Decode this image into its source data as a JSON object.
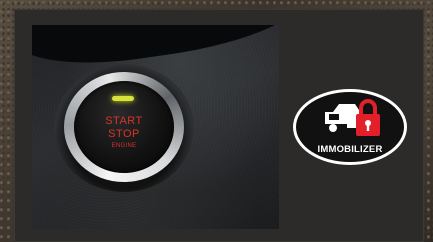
{
  "photo": {
    "button_text": {
      "line1": "START",
      "line2": "STOP",
      "line3": "ENGINE"
    },
    "led_color": "#d8e23a",
    "text_color": "#d8342a"
  },
  "badge": {
    "label": "IMMOBILIZER",
    "icon": "car-with-padlock-icon",
    "colors": {
      "outline": "#ffffff",
      "fill": "#111111",
      "lock": "#e3202a"
    }
  },
  "colors": {
    "panel": "#2c2b29"
  }
}
